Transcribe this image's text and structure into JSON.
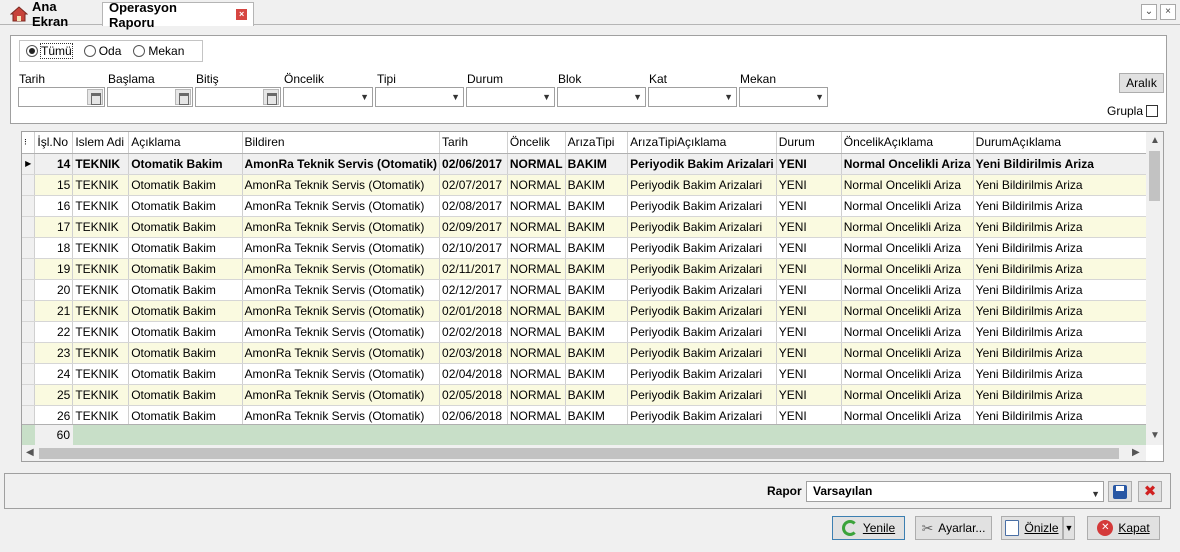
{
  "tabs": {
    "home_label": "Ana Ekran",
    "active_label": "Operasyon Raporu",
    "close_glyph": "×"
  },
  "window": {
    "dropdown_glyph": "⌄",
    "close_glyph": "×"
  },
  "filter": {
    "radio_options": [
      "Tümü",
      "Oda",
      "Mekan"
    ],
    "selected_radio": "Tümü",
    "labels": {
      "tarih": "Tarih",
      "baslama": "Başlama",
      "bitis": "Bitiş",
      "oncelik": "Öncelik",
      "tipi": "Tipi",
      "durum": "Durum",
      "blok": "Blok",
      "kat": "Kat",
      "mekan": "Mekan"
    },
    "aralik_button": "Aralık",
    "grupla_label": "Grupla",
    "grupla_checked": false
  },
  "grid": {
    "columns": [
      "İşl.No",
      "Islem Adi",
      "Açıklama",
      "Bildiren",
      "Tarih",
      "Öncelik",
      "ArızaTipi",
      "ArızaTipiAçıklama",
      "Durum",
      "ÖncelikAçıklama",
      "DurumAçıklama"
    ],
    "selected_row_index": 0,
    "rows": [
      [
        "14",
        "TEKNIK",
        "Otomatik Bakim",
        "AmonRa Teknik Servis (Otomatik)",
        "02/06/2017",
        "NORMAL",
        "BAKIM",
        "Periyodik Bakim Arizalari",
        "YENI",
        "Normal Oncelikli Ariza",
        "Yeni Bildirilmis Ariza"
      ],
      [
        "15",
        "TEKNIK",
        "Otomatik Bakim",
        "AmonRa Teknik Servis (Otomatik)",
        "02/07/2017",
        "NORMAL",
        "BAKIM",
        "Periyodik Bakim Arizalari",
        "YENI",
        "Normal Oncelikli Ariza",
        "Yeni Bildirilmis Ariza"
      ],
      [
        "16",
        "TEKNIK",
        "Otomatik Bakim",
        "AmonRa Teknik Servis (Otomatik)",
        "02/08/2017",
        "NORMAL",
        "BAKIM",
        "Periyodik Bakim Arizalari",
        "YENI",
        "Normal Oncelikli Ariza",
        "Yeni Bildirilmis Ariza"
      ],
      [
        "17",
        "TEKNIK",
        "Otomatik Bakim",
        "AmonRa Teknik Servis (Otomatik)",
        "02/09/2017",
        "NORMAL",
        "BAKIM",
        "Periyodik Bakim Arizalari",
        "YENI",
        "Normal Oncelikli Ariza",
        "Yeni Bildirilmis Ariza"
      ],
      [
        "18",
        "TEKNIK",
        "Otomatik Bakim",
        "AmonRa Teknik Servis (Otomatik)",
        "02/10/2017",
        "NORMAL",
        "BAKIM",
        "Periyodik Bakim Arizalari",
        "YENI",
        "Normal Oncelikli Ariza",
        "Yeni Bildirilmis Ariza"
      ],
      [
        "19",
        "TEKNIK",
        "Otomatik Bakim",
        "AmonRa Teknik Servis (Otomatik)",
        "02/11/2017",
        "NORMAL",
        "BAKIM",
        "Periyodik Bakim Arizalari",
        "YENI",
        "Normal Oncelikli Ariza",
        "Yeni Bildirilmis Ariza"
      ],
      [
        "20",
        "TEKNIK",
        "Otomatik Bakim",
        "AmonRa Teknik Servis (Otomatik)",
        "02/12/2017",
        "NORMAL",
        "BAKIM",
        "Periyodik Bakim Arizalari",
        "YENI",
        "Normal Oncelikli Ariza",
        "Yeni Bildirilmis Ariza"
      ],
      [
        "21",
        "TEKNIK",
        "Otomatik Bakim",
        "AmonRa Teknik Servis (Otomatik)",
        "02/01/2018",
        "NORMAL",
        "BAKIM",
        "Periyodik Bakim Arizalari",
        "YENI",
        "Normal Oncelikli Ariza",
        "Yeni Bildirilmis Ariza"
      ],
      [
        "22",
        "TEKNIK",
        "Otomatik Bakim",
        "AmonRa Teknik Servis (Otomatik)",
        "02/02/2018",
        "NORMAL",
        "BAKIM",
        "Periyodik Bakim Arizalari",
        "YENI",
        "Normal Oncelikli Ariza",
        "Yeni Bildirilmis Ariza"
      ],
      [
        "23",
        "TEKNIK",
        "Otomatik Bakim",
        "AmonRa Teknik Servis (Otomatik)",
        "02/03/2018",
        "NORMAL",
        "BAKIM",
        "Periyodik Bakim Arizalari",
        "YENI",
        "Normal Oncelikli Ariza",
        "Yeni Bildirilmis Ariza"
      ],
      [
        "24",
        "TEKNIK",
        "Otomatik Bakim",
        "AmonRa Teknik Servis (Otomatik)",
        "02/04/2018",
        "NORMAL",
        "BAKIM",
        "Periyodik Bakim Arizalari",
        "YENI",
        "Normal Oncelikli Ariza",
        "Yeni Bildirilmis Ariza"
      ],
      [
        "25",
        "TEKNIK",
        "Otomatik Bakim",
        "AmonRa Teknik Servis (Otomatik)",
        "02/05/2018",
        "NORMAL",
        "BAKIM",
        "Periyodik Bakim Arizalari",
        "YENI",
        "Normal Oncelikli Ariza",
        "Yeni Bildirilmis Ariza"
      ],
      [
        "26",
        "TEKNIK",
        "Otomatik Bakim",
        "AmonRa Teknik Servis (Otomatik)",
        "02/06/2018",
        "NORMAL",
        "BAKIM",
        "Periyodik Bakim Arizalari",
        "YENI",
        "Normal Oncelikli Ariza",
        "Yeni Bildirilmis Ariza"
      ]
    ],
    "footer_count": "60"
  },
  "rapor": {
    "label": "Rapor",
    "selected": "Varsayılan"
  },
  "buttons": {
    "yenile": "Yenile",
    "ayarlar": "Ayarlar...",
    "onizle": "Önizle",
    "kapat": "Kapat"
  },
  "colors": {
    "alt_row": "#fafae0",
    "footer_row": "#c8dfc8",
    "tab_close": "#d64541",
    "kapat_icon": "#d43a3a",
    "yenile_icon": "#3aa33a"
  }
}
